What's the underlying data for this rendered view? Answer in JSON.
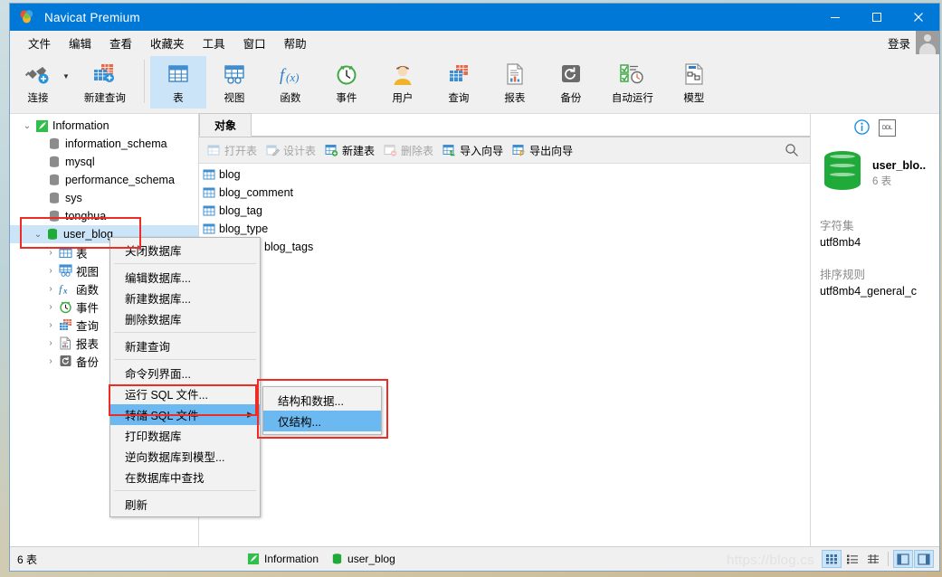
{
  "window": {
    "title": "Navicat Premium",
    "logo_icon": "navicat-logo-icon",
    "minimize_label": "─",
    "maximize_label": "☐",
    "close_label": "✕"
  },
  "menubar": {
    "items": [
      {
        "label": "文件",
        "name": "menu-file"
      },
      {
        "label": "编辑",
        "name": "menu-edit"
      },
      {
        "label": "查看",
        "name": "menu-view"
      },
      {
        "label": "收藏夹",
        "name": "menu-favorites"
      },
      {
        "label": "工具",
        "name": "menu-tools"
      },
      {
        "label": "窗口",
        "name": "menu-window"
      },
      {
        "label": "帮助",
        "name": "menu-help"
      }
    ],
    "login_label": "登录",
    "avatar_icon": "user-avatar-icon"
  },
  "toolbar": {
    "items": [
      {
        "label": "连接",
        "icon": "connection-icon",
        "name": "toolbar-connection",
        "selected": false
      },
      {
        "label": "新建查询",
        "icon": "new-query-icon",
        "name": "toolbar-new-query",
        "selected": false
      },
      {
        "label": "表",
        "icon": "table-icon",
        "name": "toolbar-table",
        "selected": true
      },
      {
        "label": "视图",
        "icon": "view-icon",
        "name": "toolbar-view",
        "selected": false
      },
      {
        "label": "函数",
        "icon": "function-icon",
        "name": "toolbar-function",
        "selected": false
      },
      {
        "label": "事件",
        "icon": "event-icon",
        "name": "toolbar-event",
        "selected": false
      },
      {
        "label": "用户",
        "icon": "user-icon",
        "name": "toolbar-user",
        "selected": false
      },
      {
        "label": "查询",
        "icon": "query-icon",
        "name": "toolbar-query",
        "selected": false
      },
      {
        "label": "报表",
        "icon": "report-icon",
        "name": "toolbar-report",
        "selected": false
      },
      {
        "label": "备份",
        "icon": "backup-icon",
        "name": "toolbar-backup",
        "selected": false
      },
      {
        "label": "自动运行",
        "icon": "automation-icon",
        "name": "toolbar-automation",
        "selected": false
      },
      {
        "label": "模型",
        "icon": "model-icon",
        "name": "toolbar-model",
        "selected": false
      }
    ]
  },
  "sidebar": {
    "connection": {
      "label": "Information",
      "icon": "connection-green-icon",
      "expanded": true
    },
    "databases": [
      {
        "label": "information_schema",
        "icon": "database-gray-icon"
      },
      {
        "label": "mysql",
        "icon": "database-gray-icon"
      },
      {
        "label": "performance_schema",
        "icon": "database-gray-icon"
      },
      {
        "label": "sys",
        "icon": "database-gray-icon"
      },
      {
        "label": "tonghua",
        "icon": "database-gray-icon"
      }
    ],
    "active_database": {
      "label": "user_blog",
      "icon": "database-green-icon",
      "expanded": true,
      "selected": true
    },
    "children": [
      {
        "label": "表",
        "icon": "table-icon",
        "name": "tree-tables"
      },
      {
        "label": "视图",
        "icon": "view-icon",
        "name": "tree-views"
      },
      {
        "label": "函数",
        "icon": "function-icon",
        "name": "tree-functions"
      },
      {
        "label": "事件",
        "icon": "event-icon",
        "name": "tree-events"
      },
      {
        "label": "查询",
        "icon": "query-icon",
        "name": "tree-queries"
      },
      {
        "label": "报表",
        "icon": "report-icon",
        "name": "tree-reports"
      },
      {
        "label": "备份",
        "icon": "backup-icon",
        "name": "tree-backups"
      }
    ]
  },
  "center": {
    "tab_label": "对象",
    "object_buttons": [
      {
        "label": "打开表",
        "icon": "open-table-icon",
        "disabled": true,
        "name": "open-table-button"
      },
      {
        "label": "设计表",
        "icon": "design-table-icon",
        "disabled": true,
        "name": "design-table-button"
      },
      {
        "label": "新建表",
        "icon": "new-table-icon",
        "disabled": false,
        "name": "new-table-button"
      },
      {
        "label": "删除表",
        "icon": "delete-table-icon",
        "disabled": true,
        "name": "delete-table-button"
      },
      {
        "label": "导入向导",
        "icon": "import-wizard-icon",
        "disabled": false,
        "name": "import-wizard-button"
      },
      {
        "label": "导出向导",
        "icon": "export-wizard-icon",
        "disabled": false,
        "name": "export-wizard-button"
      }
    ],
    "search_icon": "search-icon",
    "tables": [
      {
        "label": "blog",
        "icon": "table-icon"
      },
      {
        "label": "blog_comment",
        "icon": "table-icon"
      },
      {
        "label": "blog_tag",
        "icon": "table-icon"
      },
      {
        "label": "blog_type",
        "icon": "table-icon"
      },
      {
        "label": "blog_tags",
        "icon": "table-icon"
      }
    ]
  },
  "info_panel": {
    "info_icon": "info-circle-icon",
    "ddl_icon": "ddl-icon",
    "db_icon": "database-green-large-icon",
    "title": "user_blo..",
    "subtitle": "6 表",
    "charset_label": "字符集",
    "charset_value": "utf8mb4",
    "collation_label": "排序规则",
    "collation_value": "utf8mb4_general_c"
  },
  "context_menu": {
    "items": [
      {
        "label": "关闭数据库",
        "type": "item",
        "name": "ctx-close-database"
      },
      {
        "type": "separator"
      },
      {
        "label": "编辑数据库...",
        "type": "item",
        "name": "ctx-edit-database"
      },
      {
        "label": "新建数据库...",
        "type": "item",
        "name": "ctx-new-database"
      },
      {
        "label": "删除数据库",
        "type": "item",
        "name": "ctx-delete-database"
      },
      {
        "type": "separator"
      },
      {
        "label": "新建查询",
        "type": "item",
        "name": "ctx-new-query"
      },
      {
        "type": "separator"
      },
      {
        "label": "命令列界面...",
        "type": "item",
        "name": "ctx-command-line"
      },
      {
        "label": "运行 SQL 文件...",
        "type": "item",
        "name": "ctx-run-sql-file"
      },
      {
        "label": "转储 SQL 文件",
        "type": "item",
        "highlighted": true,
        "submenu": true,
        "arrow": "▶",
        "name": "ctx-dump-sql-file"
      },
      {
        "label": "打印数据库",
        "type": "item",
        "name": "ctx-print-database"
      },
      {
        "label": "逆向数据库到模型...",
        "type": "item",
        "name": "ctx-reverse-database-to-model"
      },
      {
        "label": "在数据库中查找",
        "type": "item",
        "name": "ctx-find-in-database"
      },
      {
        "type": "separator"
      },
      {
        "label": "刷新",
        "type": "item",
        "name": "ctx-refresh"
      }
    ]
  },
  "submenu": {
    "items": [
      {
        "label": "结构和数据...",
        "highlighted": false,
        "name": "submenu-structure-and-data"
      },
      {
        "label": "仅结构...",
        "highlighted": true,
        "name": "submenu-structure-only"
      }
    ]
  },
  "statusbar": {
    "left_text": "6 表",
    "connection": {
      "label": "Information",
      "icon": "connection-green-icon"
    },
    "database": {
      "label": "user_blog",
      "icon": "database-green-icon"
    },
    "view_buttons": [
      {
        "icon": "grid-view-icon",
        "active": true,
        "name": "grid-view-button"
      },
      {
        "icon": "list-view-icon",
        "active": false,
        "name": "list-view-button"
      },
      {
        "icon": "detail-view-icon",
        "active": false,
        "name": "detail-view-button"
      },
      {
        "icon": "left-pane-toggle-icon",
        "active": true,
        "name": "left-pane-toggle"
      },
      {
        "icon": "right-pane-toggle-icon",
        "active": true,
        "name": "right-pane-toggle"
      }
    ],
    "watermark": "https://blog.cs"
  },
  "colors": {
    "titlebar": "#0078d7",
    "selection": "#cce4f7",
    "menu_highlight": "#6cb8f0",
    "annotation_red": "#ee2b24",
    "green_db": "#1faa39"
  }
}
